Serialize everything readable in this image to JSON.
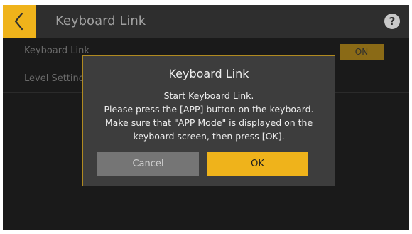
{
  "header": {
    "title": "Keyboard Link",
    "back_icon": "chevron-left-icon",
    "help_label": "?"
  },
  "settings": {
    "rows": [
      {
        "label": "Keyboard Link",
        "value": "ON"
      },
      {
        "label": "Level Setting"
      }
    ]
  },
  "dialog": {
    "title": "Keyboard Link",
    "lines": [
      "Start Keyboard Link.",
      "Please press the [APP] button on the keyboard.",
      "Make sure that \"APP Mode\" is displayed on the",
      "keyboard screen, then press [OK]."
    ],
    "cancel_label": "Cancel",
    "ok_label": "OK"
  },
  "colors": {
    "accent": "#efb31b",
    "background": "#1a1a1a",
    "titlebar": "#2e2e2e",
    "dialog_background": "#3d3d3d",
    "cancel_button": "#757575"
  }
}
